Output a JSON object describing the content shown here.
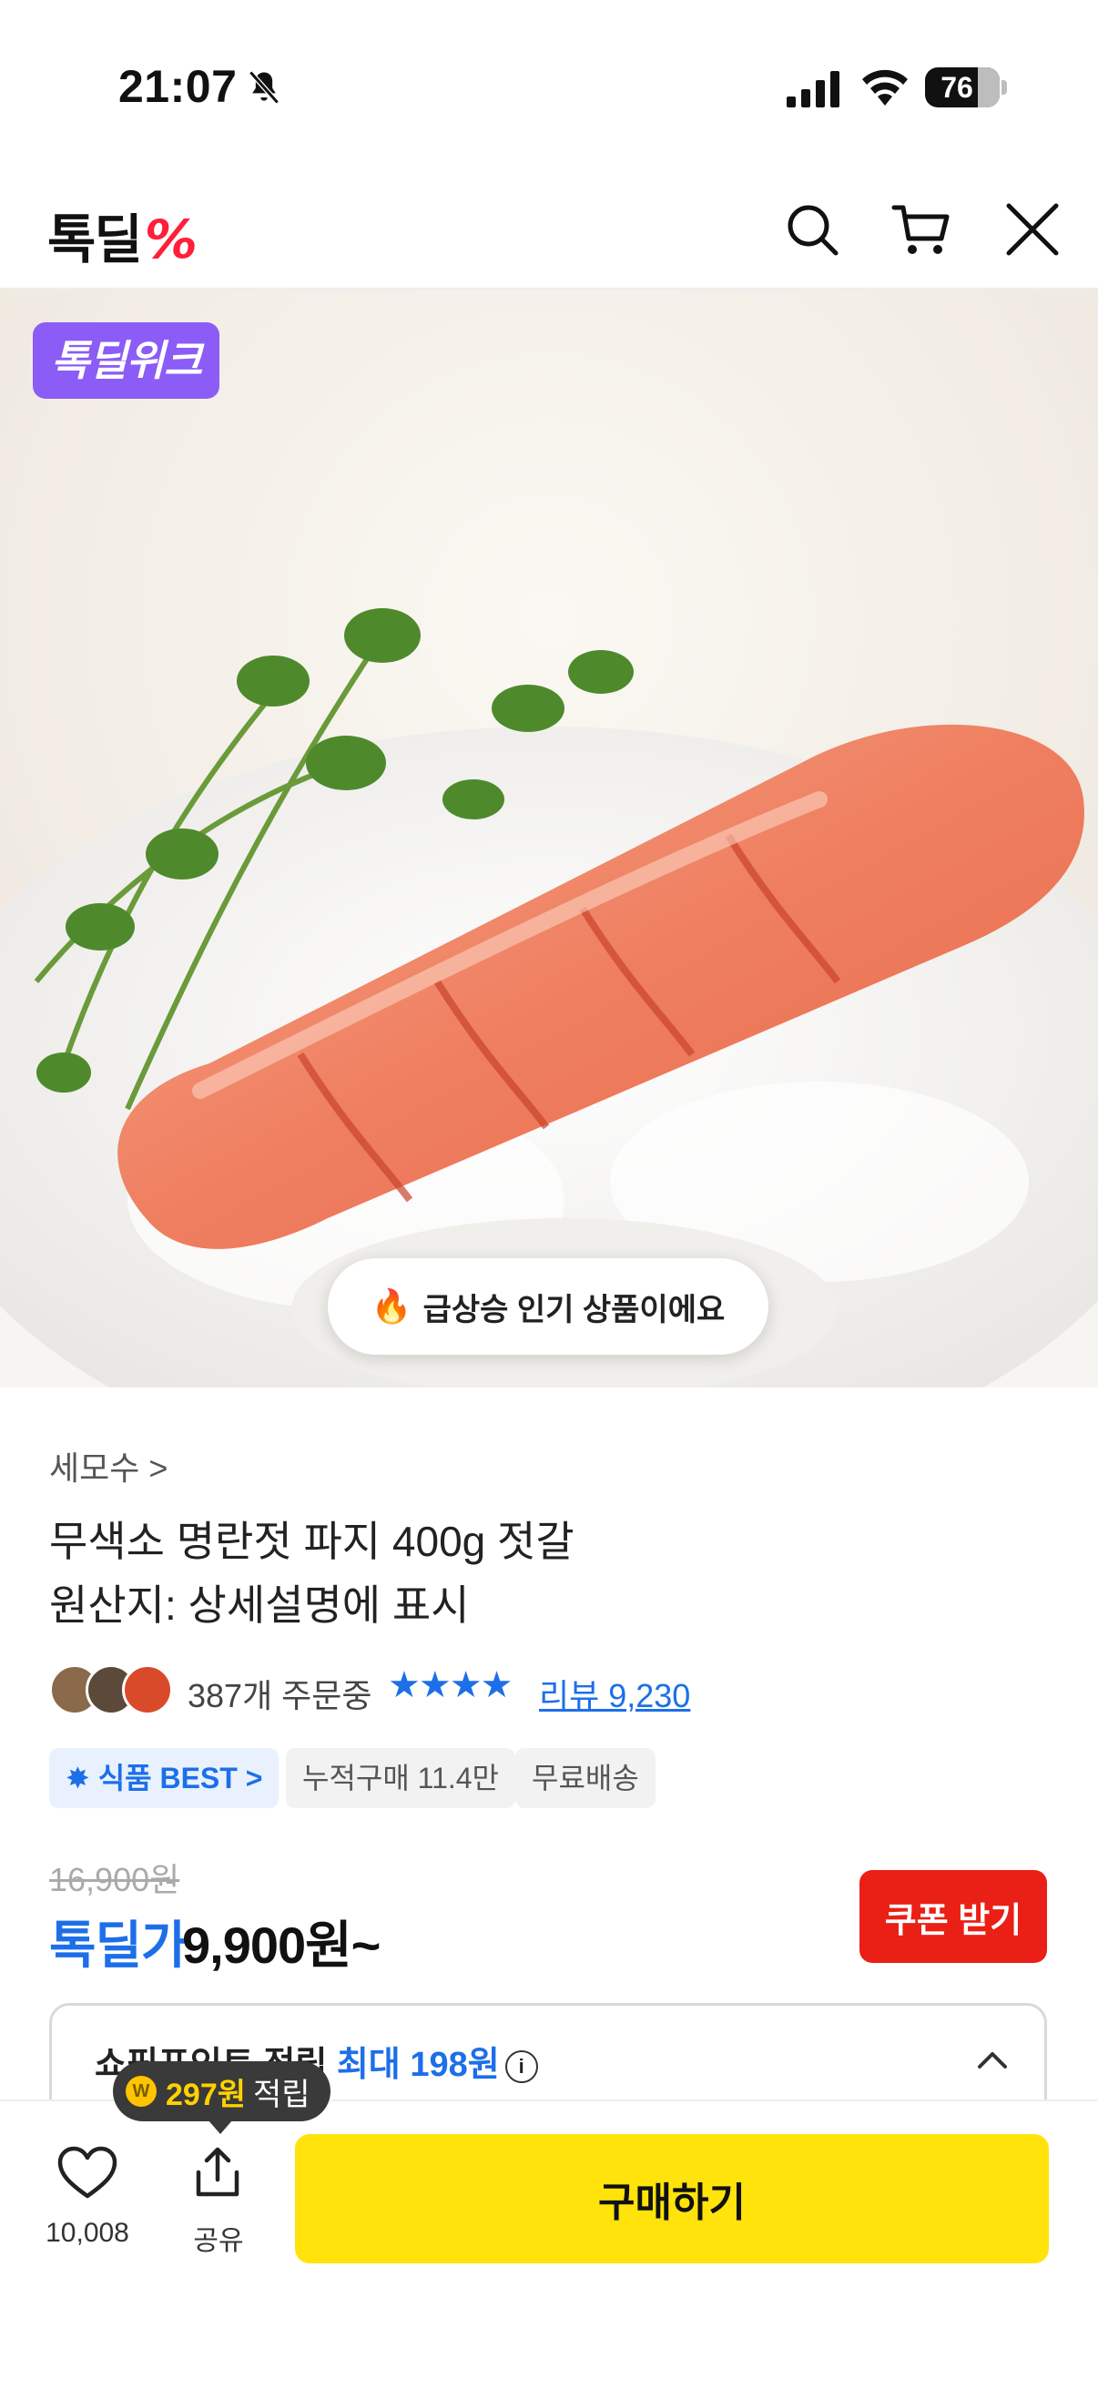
{
  "status_bar": {
    "time": "21:07",
    "battery": "76"
  },
  "header": {
    "logo_text": "톡딜",
    "logo_suffix": "%"
  },
  "hero": {
    "badge": "톡딜위크",
    "trending_label": "급상승 인기 상품이에요"
  },
  "product": {
    "brand": "세모수 >",
    "title_line1": "무색소 명란젓 파지 400g 젓갈",
    "title_line2": "원산지: 상세설명에 표시",
    "order_count": "387개 주문중",
    "stars": "★★★★",
    "review_link": "리뷰 9,230",
    "chips": [
      "식품 BEST >",
      "누적구매 11.4만",
      "무료배송"
    ]
  },
  "price": {
    "original": "16,900원",
    "deal_label": "톡딜가",
    "deal_price": "9,900원~",
    "coupon_button": "쿠폰 받기"
  },
  "points": {
    "label": "쇼핑포인트 적립",
    "max_label": "최대 198원",
    "info_icon": "i"
  },
  "tooltip": {
    "coin_icon": "W",
    "amount": "297원",
    "suffix": "적립"
  },
  "bottom_bar": {
    "like_count": "10,008",
    "share_label": "공유",
    "buy_button": "구매하기"
  },
  "colors": {
    "brand_blue": "#1d6fe8",
    "coupon_red": "#ea1f15",
    "buy_yellow": "#ffe30a",
    "badge_purple": "#8b5cf6"
  }
}
